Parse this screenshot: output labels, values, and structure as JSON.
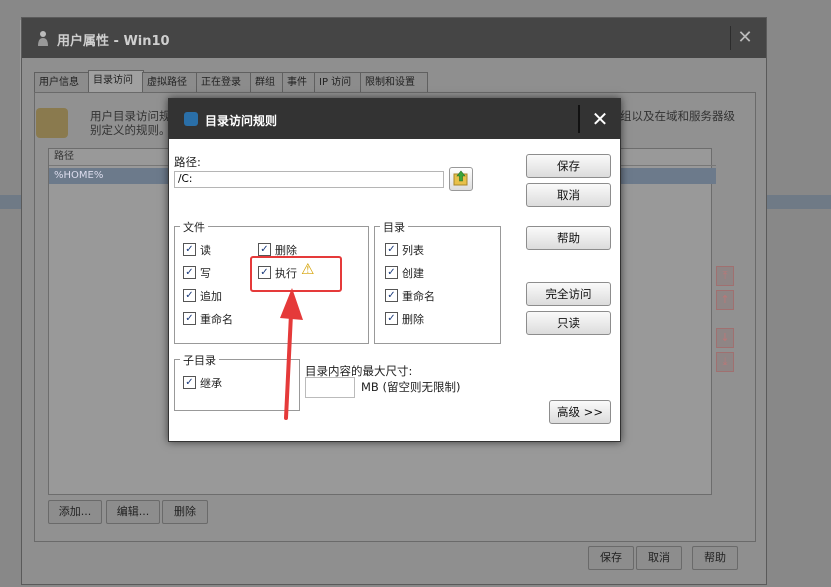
{
  "window": {
    "title": "用户属性 - Win10",
    "close_glyph": "✕",
    "tabs": [
      "用户信息",
      "目录访问",
      "虚拟路径",
      "正在登录",
      "群组",
      "事件",
      "IP 访问",
      "限制和设置"
    ],
    "info_text_line1": "用户目录访问规",
    "info_text_line2": "别定义的规则。",
    "info_text_tail": "组以及在域和服务器级",
    "list_header": "路径",
    "list_row": "%HOME%",
    "bottom_buttons": [
      "添加...",
      "编辑...",
      "删除"
    ],
    "footer_buttons": [
      "保存",
      "取消",
      "帮助"
    ]
  },
  "dialog": {
    "title": "目录访问规则",
    "close_glyph": "✕",
    "path_label": "路径:",
    "path_value": "/C:",
    "files_legend": "文件",
    "files": [
      {
        "label": "读",
        "checked": true
      },
      {
        "label": "写",
        "checked": true
      },
      {
        "label": "追加",
        "checked": true
      },
      {
        "label": "重命名",
        "checked": true
      },
      {
        "label": "删除",
        "checked": true
      },
      {
        "label": "执行",
        "checked": true
      }
    ],
    "dirs_legend": "目录",
    "dirs": [
      {
        "label": "列表",
        "checked": true
      },
      {
        "label": "创建",
        "checked": true
      },
      {
        "label": "重命名",
        "checked": true
      },
      {
        "label": "删除",
        "checked": true
      }
    ],
    "subdir_legend": "子目录",
    "subdir_inherit": "继承",
    "max_size_label": "目录内容的最大尺寸:",
    "size_unit": "MB  (留空则无限制)",
    "buttons": {
      "save": "保存",
      "cancel": "取消",
      "help": "帮助",
      "full_access": "完全访问",
      "read_only": "只读",
      "advanced": "高级 >>"
    },
    "check_glyph": "✓",
    "warning_glyph": "⚠"
  },
  "colors": {
    "annotation_red": "#e53a3a",
    "dialog_titlebar": "#333333",
    "window_titlebar": "#454545"
  }
}
